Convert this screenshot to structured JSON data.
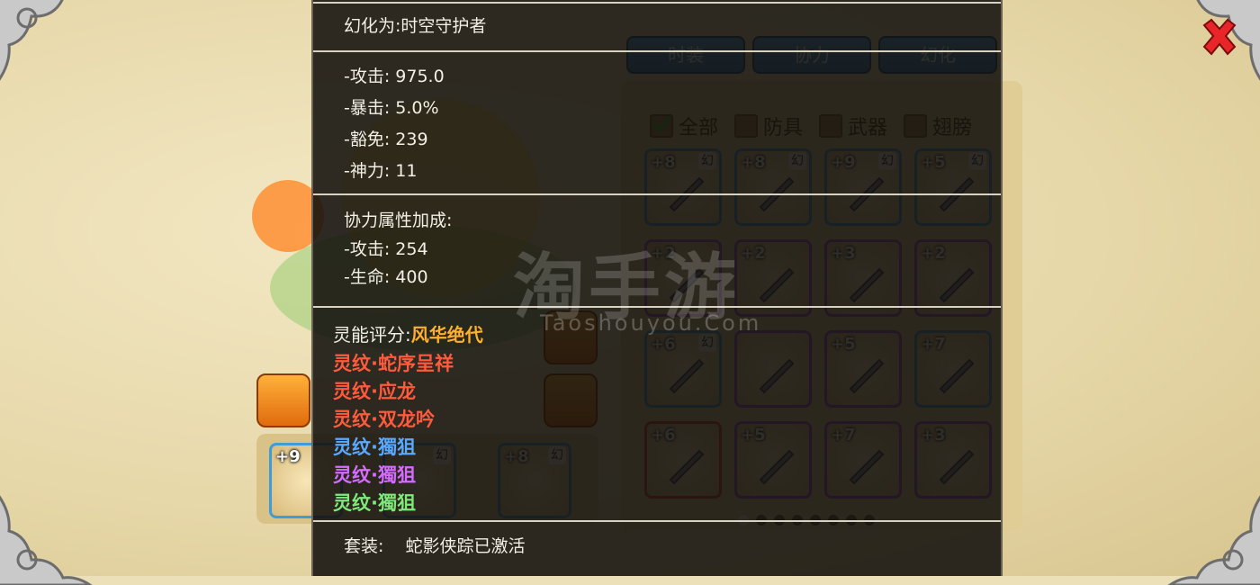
{
  "background": {
    "tabs": [
      "时装",
      "协力",
      "幻化"
    ],
    "filters": [
      {
        "label": "全部",
        "checked": true
      },
      {
        "label": "防具",
        "checked": false
      },
      {
        "label": "武器",
        "checked": false
      },
      {
        "label": "翅膀",
        "checked": false
      }
    ],
    "grid": [
      {
        "level": "+8",
        "tag": "幻",
        "border": "blue"
      },
      {
        "level": "+8",
        "tag": "幻",
        "border": "blue"
      },
      {
        "level": "+9",
        "tag": "幻",
        "border": "blue"
      },
      {
        "level": "+5",
        "tag": "幻",
        "border": "blue"
      },
      {
        "level": "+2",
        "tag": "",
        "border": "purple"
      },
      {
        "level": "+2",
        "tag": "",
        "border": "purple"
      },
      {
        "level": "+3",
        "tag": "",
        "border": "purple"
      },
      {
        "level": "+2",
        "tag": "",
        "border": "purple"
      },
      {
        "level": "+6",
        "tag": "幻",
        "border": "blue"
      },
      {
        "level": "",
        "tag": "",
        "border": "purple"
      },
      {
        "level": "+5",
        "tag": "",
        "border": "purple"
      },
      {
        "level": "+7",
        "tag": "",
        "border": "blue"
      },
      {
        "level": "+6",
        "tag": "",
        "border": "red"
      },
      {
        "level": "+5",
        "tag": "",
        "border": "purple"
      },
      {
        "level": "+7",
        "tag": "",
        "border": "purple"
      },
      {
        "level": "+3",
        "tag": "",
        "border": "purple"
      }
    ],
    "bottom_slots": [
      {
        "level": "+9"
      },
      {
        "level": "",
        "tag": "幻"
      },
      {
        "level": "+8",
        "tag": "幻"
      }
    ],
    "watermark": "淘手游",
    "watermark_sub": "Taoshouyou.Com"
  },
  "tooltip": {
    "title": "幻化为:时空守护者",
    "stats": [
      "-攻击: 975.0",
      "-暴击: 5.0%",
      "-豁免: 239",
      "-神力: 11"
    ],
    "bonus_title": "协力属性加成:",
    "bonus_stats": [
      "-攻击: 254",
      "-生命: 400"
    ],
    "score_label": "灵能评分:",
    "score_value": "风华绝代",
    "runes": [
      {
        "text": "灵纹·蛇序呈祥",
        "color": "#ff5a3c"
      },
      {
        "text": "灵纹·应龙",
        "color": "#ff5a3c"
      },
      {
        "text": "灵纹·双龙吟",
        "color": "#ff5a3c"
      },
      {
        "text": "灵纹·獨狙",
        "color": "#5aa8ff"
      },
      {
        "text": "灵纹·獨狙",
        "color": "#d66bff"
      },
      {
        "text": "灵纹·獨狙",
        "color": "#7ee87a"
      }
    ],
    "set_label": "套装:",
    "set_value": "蛇影侠踪已激活"
  }
}
